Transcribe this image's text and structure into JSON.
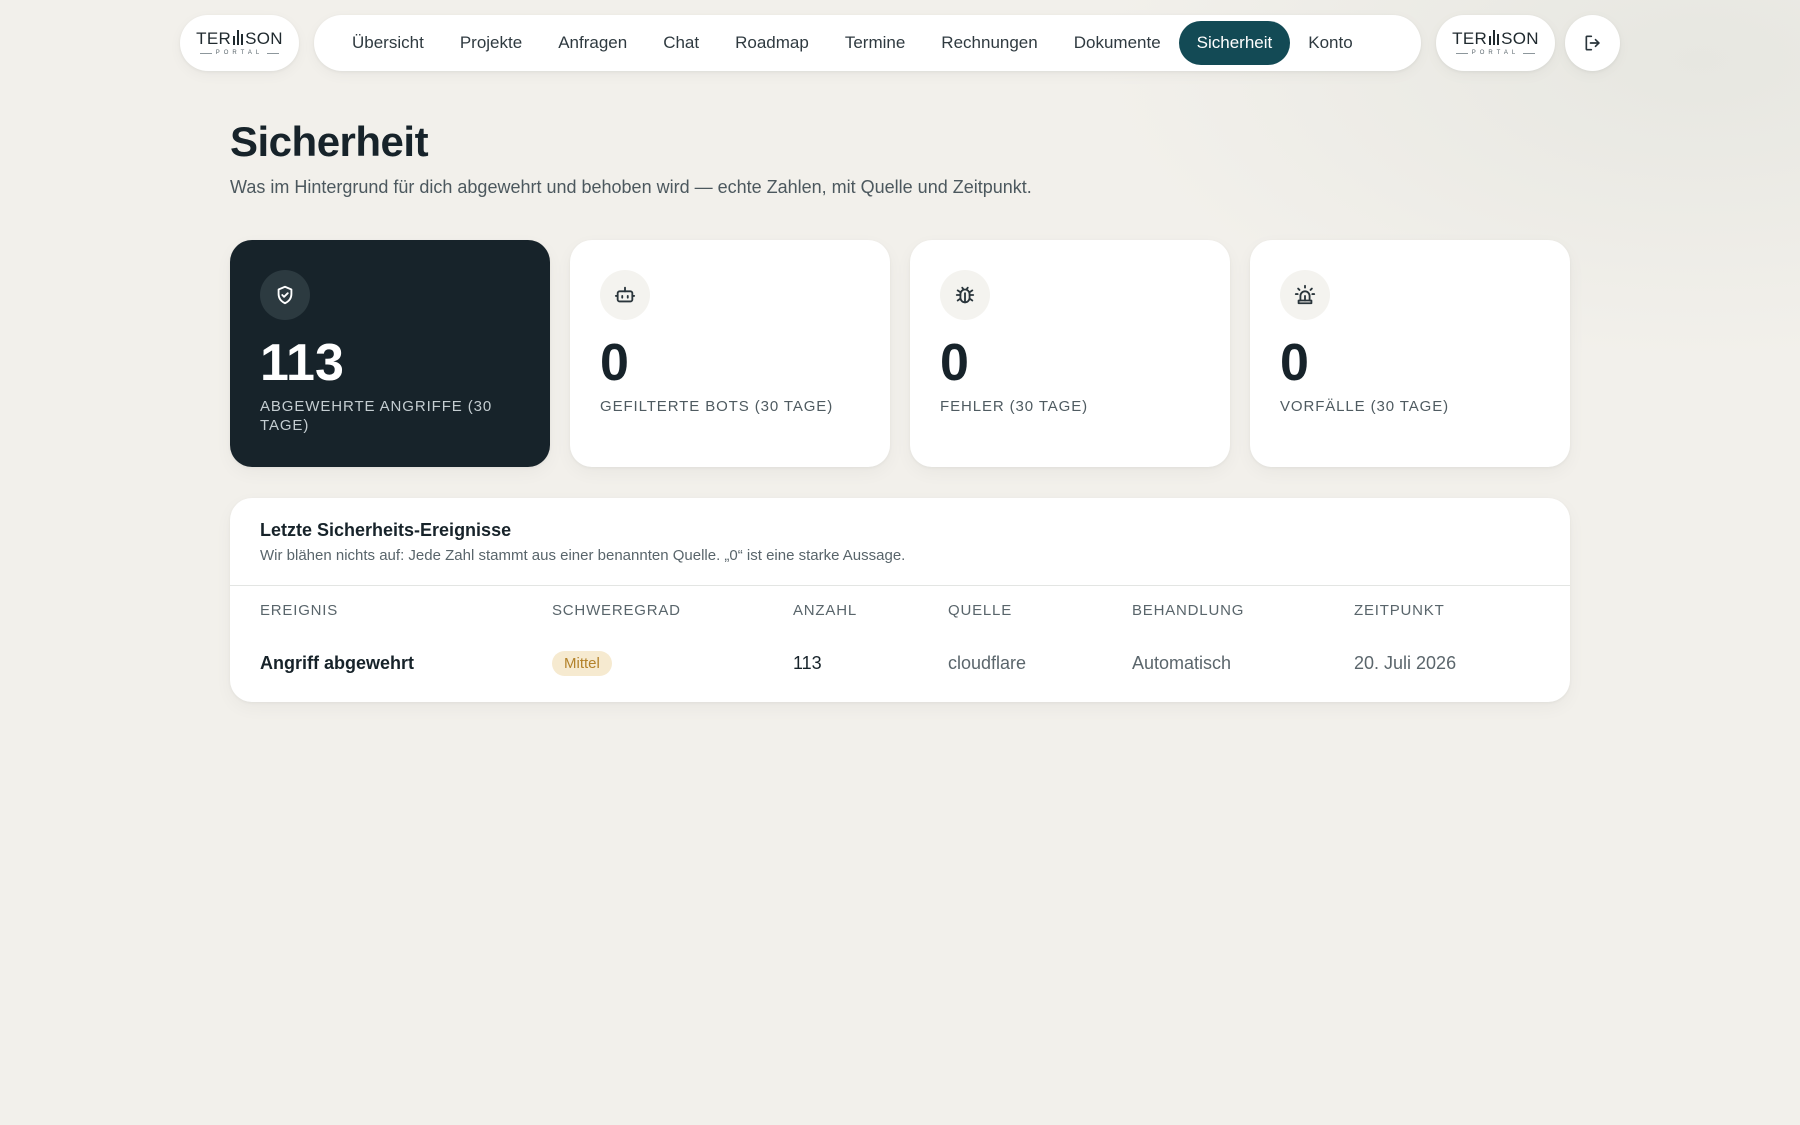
{
  "brand": {
    "logo_text_left": "TER",
    "logo_text_right": "SON",
    "logo_sub": "PORTAL"
  },
  "nav": {
    "items": [
      {
        "label": "Übersicht",
        "active": false
      },
      {
        "label": "Projekte",
        "active": false
      },
      {
        "label": "Anfragen",
        "active": false
      },
      {
        "label": "Chat",
        "active": false
      },
      {
        "label": "Roadmap",
        "active": false
      },
      {
        "label": "Termine",
        "active": false
      },
      {
        "label": "Rechnungen",
        "active": false
      },
      {
        "label": "Dokumente",
        "active": false
      },
      {
        "label": "Sicherheit",
        "active": true
      },
      {
        "label": "Konto",
        "active": false
      }
    ],
    "logout_icon": "logout-icon"
  },
  "page": {
    "title": "Sicherheit",
    "subtitle": "Was im Hintergrund für dich abgewehrt und behoben wird — echte Zahlen, mit Quelle und Zeitpunkt."
  },
  "stats": [
    {
      "icon": "shield-check-icon",
      "value": "113",
      "label": "ABGEWEHRTE ANGRIFFE (30 TAGE)",
      "highlight": true
    },
    {
      "icon": "bot-icon",
      "value": "0",
      "label": "GEFILTERTE BOTS (30 TAGE)",
      "highlight": false
    },
    {
      "icon": "bug-icon",
      "value": "0",
      "label": "FEHLER (30 TAGE)",
      "highlight": false
    },
    {
      "icon": "siren-icon",
      "value": "0",
      "label": "VORFÄLLE (30 TAGE)",
      "highlight": false
    }
  ],
  "events": {
    "title": "Letzte Sicherheits-Ereignisse",
    "description": "Wir blähen nichts auf: Jede Zahl stammt aus einer benannten Quelle. „0“ ist eine starke Aussage.",
    "columns": [
      "EREIGNIS",
      "SCHWEREGRAD",
      "ANZAHL",
      "QUELLE",
      "BEHANDLUNG",
      "ZEITPUNKT"
    ],
    "rows": [
      {
        "event": "Angriff abgewehrt",
        "severity": "Mittel",
        "count": "113",
        "source": "cloudflare",
        "handling": "Automatisch",
        "time": "20. Juli 2026"
      }
    ]
  },
  "colors": {
    "accent": "#134a55",
    "dark_card": "#17232a",
    "badge_bg": "#f6ead0",
    "badge_text": "#b3822a",
    "background": "#f2f0eb"
  }
}
